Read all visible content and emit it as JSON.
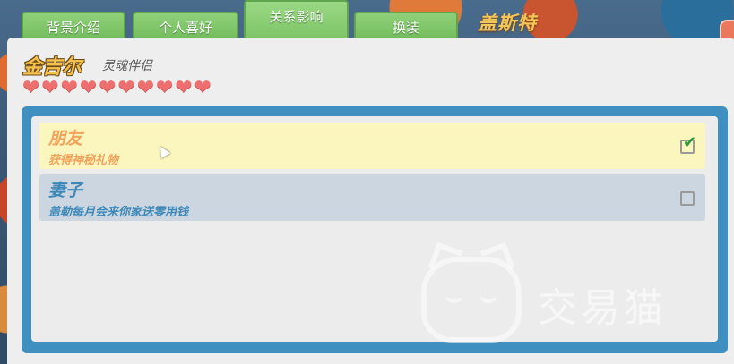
{
  "background": {
    "character_label": "盖斯特"
  },
  "tabs": [
    {
      "label": "背景介绍",
      "active": false
    },
    {
      "label": "个人喜好",
      "active": false
    },
    {
      "label": "关系影响",
      "active": true
    },
    {
      "label": "换装",
      "active": false
    }
  ],
  "character": {
    "name": "金吉尔",
    "title": "灵魂伴侣",
    "hearts_filled": 10,
    "hearts_total": 10,
    "heart_glyph": "❤"
  },
  "relationships": [
    {
      "title": "朋友",
      "description": "获得神秘礼物",
      "checked": true,
      "check_glyph": "✔"
    },
    {
      "title": "妻子",
      "description": "盖勒每月会来你家送零用钱",
      "checked": false
    }
  ],
  "watermark": {
    "text": "交易猫"
  },
  "colors": {
    "tab_green": "#7cc465",
    "frame_blue": "#3f8fc0",
    "friend_row": "#fbf6bd",
    "wife_row": "#ccd6e1",
    "heart": "#ee6f6f",
    "name_gold": "#f4c04e"
  }
}
